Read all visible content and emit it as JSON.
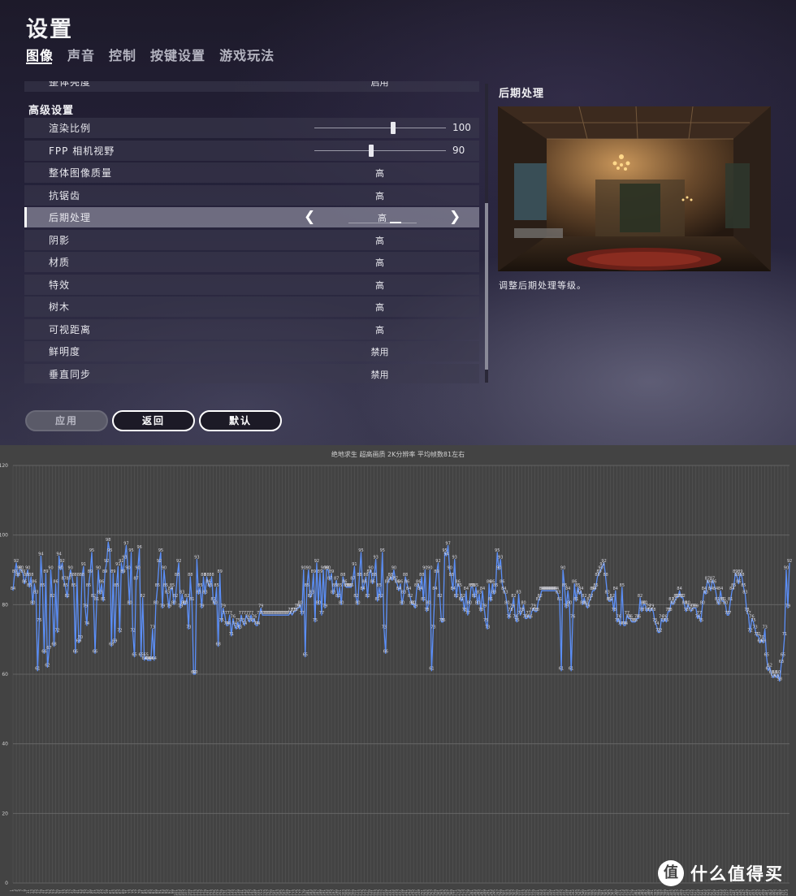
{
  "header": {
    "title": "设置"
  },
  "tabs": [
    {
      "label": "图像",
      "active": true
    },
    {
      "label": "声音",
      "active": false
    },
    {
      "label": "控制",
      "active": false
    },
    {
      "label": "按键设置",
      "active": false
    },
    {
      "label": "游戏玩法",
      "active": false
    }
  ],
  "settings": {
    "partial_row": {
      "label": "整体亮度",
      "value": "启用"
    },
    "section_title": "高级设置",
    "render_scale": {
      "label": "渲染比例",
      "value": "100",
      "fraction": 0.6
    },
    "fpp_fov": {
      "label": "FPP 相机视野",
      "value": "90",
      "fraction": 0.43
    },
    "rows": [
      {
        "label": "整体图像质量",
        "value": "高"
      },
      {
        "label": "抗锯齿",
        "value": "高"
      },
      {
        "label": "后期处理",
        "value": "高",
        "selected": true
      },
      {
        "label": "阴影",
        "value": "高"
      },
      {
        "label": "材质",
        "value": "高"
      },
      {
        "label": "特效",
        "value": "高"
      },
      {
        "label": "树木",
        "value": "高"
      },
      {
        "label": "可视距离",
        "value": "高"
      },
      {
        "label": "鲜明度",
        "value": "禁用"
      },
      {
        "label": "垂直同步",
        "value": "禁用"
      }
    ]
  },
  "preview": {
    "title": "后期处理",
    "description": "调整后期处理等级。"
  },
  "buttons": {
    "apply": "应用",
    "back": "返回",
    "default": "默认"
  },
  "watermark": {
    "logo_char": "值",
    "text": "什么值得买"
  },
  "colors": {
    "line": "#5b8ff9",
    "chart_bg": "#434343",
    "grid": "#5a5a5a"
  },
  "chart_data": {
    "type": "line",
    "title": "绝地求生 超高画质 2K分辨率 平均帧数81左右",
    "ylim": [
      0,
      120
    ],
    "yticks": [
      0,
      20,
      40,
      60,
      80,
      100,
      120
    ],
    "series": [
      {
        "values": [
          84,
          89,
          92,
          88,
          90,
          90,
          89,
          86,
          88,
          90,
          85,
          88,
          80,
          86,
          83,
          61,
          75,
          94,
          85,
          66,
          89,
          62,
          67,
          90,
          82,
          68,
          86,
          72,
          94,
          90,
          92,
          87,
          85,
          82,
          87,
          90,
          88,
          85,
          66,
          88,
          69,
          70,
          88,
          91,
          79,
          74,
          85,
          89,
          95,
          82,
          66,
          81,
          90,
          83,
          86,
          81,
          89,
          92,
          98,
          95,
          68,
          89,
          69,
          85,
          91,
          72,
          92,
          89,
          93,
          97,
          90,
          80,
          95,
          72,
          65,
          87,
          90,
          96,
          65,
          82,
          64,
          65,
          64,
          64,
          64,
          73,
          64,
          80,
          85,
          92,
          95,
          79,
          90,
          85,
          83,
          79,
          84,
          85,
          80,
          82,
          88,
          92,
          79,
          83,
          80,
          80,
          82,
          73,
          88,
          81,
          60,
          60,
          93,
          83,
          85,
          79,
          88,
          83,
          88,
          86,
          85,
          88,
          81,
          80,
          85,
          68,
          89,
          75,
          79,
          77,
          74,
          74,
          77,
          71,
          76,
          74,
          73,
          75,
          73,
          77,
          75,
          74,
          77,
          76,
          75,
          77,
          75,
          76,
          74,
          74,
          77,
          79,
          77,
          77,
          77,
          77,
          77,
          77,
          77,
          77,
          77,
          77,
          77,
          77,
          77,
          77,
          77,
          77,
          77,
          78,
          77,
          78,
          78,
          79,
          79,
          80,
          77,
          90,
          65,
          85,
          90,
          82,
          83,
          89,
          75,
          92,
          80,
          89,
          77,
          90,
          79,
          90,
          90,
          87,
          89,
          83,
          85,
          87,
          82,
          85,
          80,
          88,
          86,
          85,
          85,
          85,
          85,
          87,
          91,
          82,
          80,
          88,
          95,
          84,
          86,
          88,
          82,
          89,
          90,
          86,
          88,
          93,
          81,
          85,
          82,
          95,
          73,
          66,
          86,
          87,
          88,
          87,
          90,
          87,
          86,
          84,
          86,
          80,
          83,
          88,
          86,
          84,
          82,
          80,
          80,
          79,
          85,
          86,
          84,
          88,
          81,
          90,
          78,
          80,
          90,
          61,
          73,
          84,
          89,
          92,
          82,
          75,
          75,
          95,
          94,
          97,
          90,
          88,
          84,
          93,
          82,
          86,
          85,
          81,
          82,
          78,
          84,
          77,
          80,
          85,
          85,
          82,
          85,
          80,
          83,
          78,
          84,
          79,
          75,
          73,
          86,
          81,
          86,
          83,
          85,
          95,
          90,
          93,
          86,
          84,
          83,
          80,
          76,
          78,
          79,
          82,
          76,
          75,
          83,
          77,
          78,
          80,
          76,
          76,
          77,
          76,
          78,
          79,
          78,
          78,
          81,
          82,
          84,
          84,
          84,
          84,
          84,
          84,
          84,
          84,
          84,
          84,
          83,
          81,
          61,
          90,
          85,
          79,
          84,
          80,
          61,
          76,
          86,
          81,
          85,
          83,
          84,
          80,
          82,
          80,
          79,
          81,
          82,
          84,
          84,
          85,
          88,
          89,
          90,
          91,
          92,
          88,
          83,
          81,
          81,
          82,
          78,
          84,
          75,
          76,
          74,
          85,
          74,
          74,
          77,
          76,
          76,
          75,
          75,
          75,
          76,
          76,
          82,
          78,
          80,
          80,
          78,
          79,
          78,
          79,
          78,
          75,
          74,
          72,
          72,
          76,
          75,
          76,
          75,
          78,
          78,
          81,
          80,
          81,
          82,
          82,
          84,
          82,
          82,
          80,
          78,
          80,
          79,
          78,
          79,
          79,
          79,
          76,
          77,
          75,
          80,
          84,
          83,
          87,
          86,
          84,
          87,
          86,
          84,
          81,
          80,
          84,
          81,
          81,
          80,
          77,
          77,
          81,
          84,
          85,
          89,
          88,
          86,
          89,
          88,
          85,
          83,
          78,
          77,
          72,
          76,
          75,
          73,
          71,
          71,
          69,
          70,
          69,
          73,
          65,
          61,
          62,
          60,
          59,
          60,
          59,
          60,
          58,
          63,
          65,
          71,
          90,
          79,
          92
        ]
      }
    ]
  }
}
